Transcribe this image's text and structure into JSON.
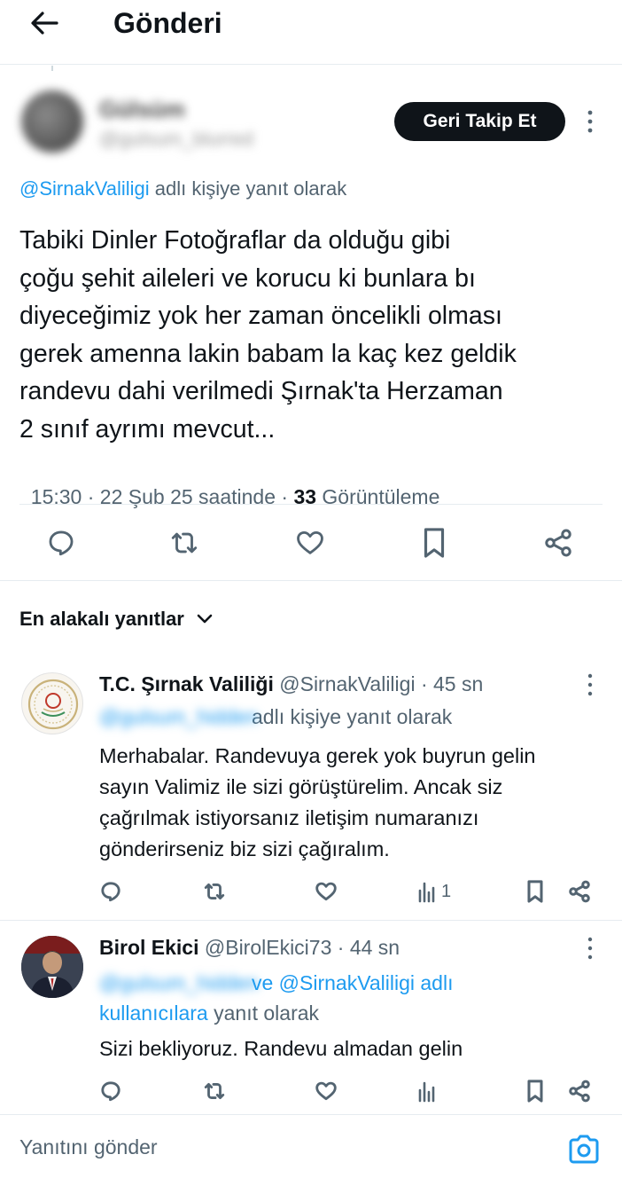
{
  "header": {
    "title": "Gönderi"
  },
  "post": {
    "author_name": "Gülsüm",
    "author_handle": "@gulsum_blurred",
    "follow_button": "Geri Takip Et",
    "reply_handle": "@SirnakValiligi",
    "reply_suffix": "adlı kişiye yanıt olarak",
    "text_lines": [
      "Tabiki Dinler Fotoğraflar da olduğu gibi",
      "çoğu şehit aileleri ve korucu ki bunlara bı",
      "diyeceğimiz yok her zaman öncelikli olması",
      "gerek amenna lakin babam la kaç kez geldik",
      "randevu dahi verilmedi Şırnak'ta Herzaman",
      "2 sınıf ayrımı mevcut..."
    ],
    "time": "15:30 · 22 Şub 25 saatinde · ",
    "views_count": "33",
    "views_label": " Görüntüleme"
  },
  "sort": {
    "label": "En alakalı yanıtlar"
  },
  "replies": [
    {
      "name": "T.C. Şırnak Valiliği",
      "handle": "@SirnakValiligi",
      "time": "· 45 sn",
      "reply_to_hidden": "@gulsum_hidden",
      "reply_suffix": "adlı kişiye yanıt olarak",
      "text_lines": [
        "Merhabalar. Randevuya gerek yok buyrun gelin",
        "sayın Valimiz ile sizi görüştürelim. Ancak siz",
        "çağrılmak istiyorsanız iletişim numaranızı",
        "gönderirseniz biz sizi çağıralım."
      ],
      "views": "1"
    },
    {
      "name": "Birol Ekici",
      "handle": "@BirolEkici73",
      "time": "· 44 sn",
      "reply_to_hidden": "@gulsum_hidden",
      "reply_mid": "ve @SirnakValiligi adlı",
      "reply_line2_link": "kullanıcılara",
      "reply_line2_suffix": " yanıt olarak",
      "text_lines": [
        "Sizi bekliyoruz. Randevu almadan gelin"
      ],
      "views": ""
    }
  ],
  "composer": {
    "placeholder": "Yanıtını gönder"
  },
  "icons": [
    "back-arrow-icon",
    "more-icon",
    "reply-icon",
    "retweet-icon",
    "like-icon",
    "bookmark-icon",
    "share-icon",
    "chevron-down-icon",
    "views-icon",
    "camera-icon"
  ],
  "colors": {
    "accent": "#1d9bf0",
    "text": "#0f1419",
    "secondary": "#536471",
    "button_bg": "#0f1419"
  }
}
